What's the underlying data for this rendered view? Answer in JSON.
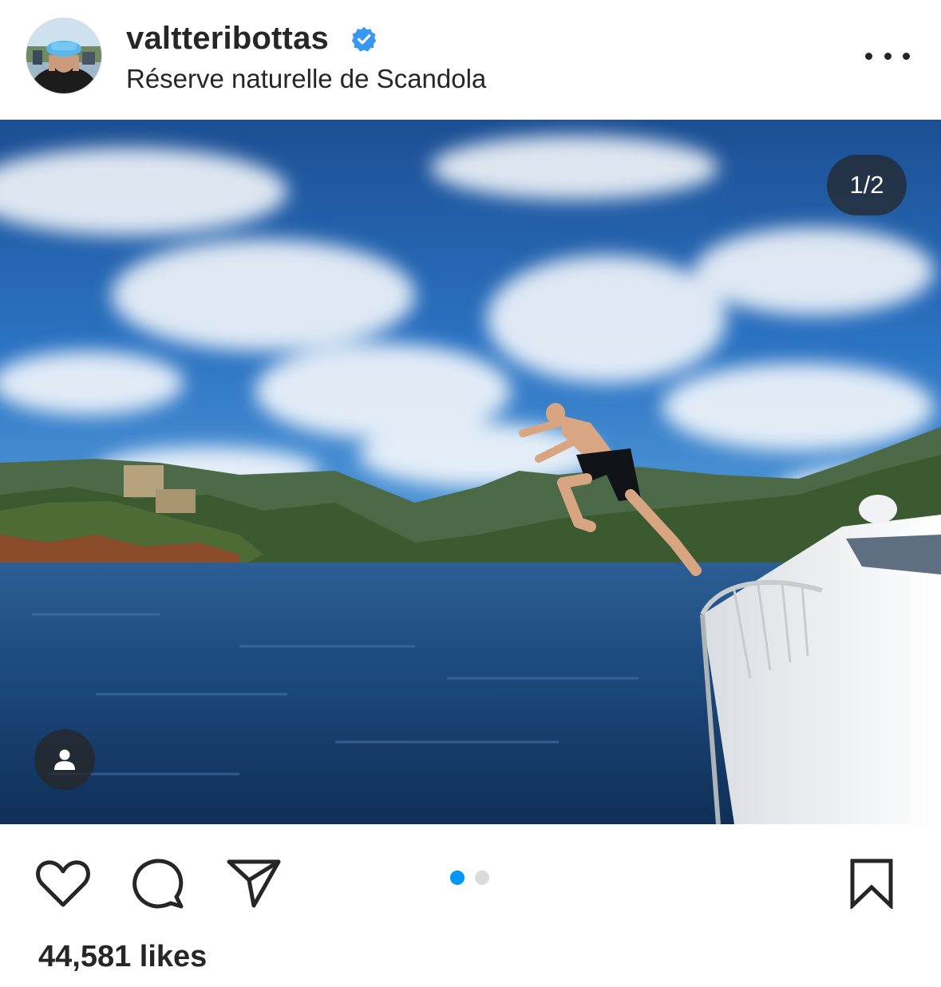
{
  "post": {
    "username": "valtteribottas",
    "location": "Réserve naturelle de Scandola",
    "media_counter": "1/2",
    "likes": "44,581 likes"
  },
  "icons": {
    "verified": "verified-badge-icon",
    "more": "more-options-icon",
    "tag": "user-tag-icon",
    "like": "heart-icon",
    "comment": "comment-icon",
    "share": "send-icon",
    "save": "bookmark-icon"
  },
  "carousel": {
    "total": 2,
    "active_index": 1
  },
  "colors": {
    "verified_blue": "#3897f0",
    "active_dot": "#0095f6",
    "inactive_dot": "#dbdbdb",
    "text": "#262626"
  }
}
